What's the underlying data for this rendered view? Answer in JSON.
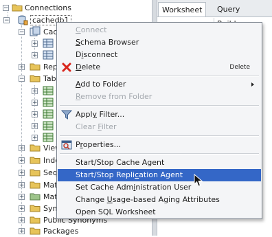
{
  "tree": {
    "items": [
      {
        "label": "Connections",
        "icon": "folder-icon"
      },
      {
        "label": "cachedb1",
        "icon": "database-icon"
      },
      {
        "label": "Cac",
        "icon": "cache-groups-icon"
      },
      {
        "label": "Rep",
        "icon": "folder-icon"
      },
      {
        "label": "Tab",
        "icon": "folder-icon"
      },
      {
        "label": "View",
        "icon": "folder-icon"
      },
      {
        "label": "Inde",
        "icon": "folder-icon"
      },
      {
        "label": "Seq",
        "icon": "folder-icon"
      },
      {
        "label": "Mat",
        "icon": "folder-icon"
      },
      {
        "label": "Mat",
        "icon": "folder-icon"
      },
      {
        "label": "Syn",
        "icon": "folder-icon"
      },
      {
        "label": "Public Synonyms",
        "icon": "folder-icon"
      },
      {
        "label": "Packages",
        "icon": "folder-icon"
      }
    ]
  },
  "editor": {
    "tabs": [
      {
        "label": "Worksheet"
      },
      {
        "label": "Query Builder"
      }
    ]
  },
  "menu": {
    "items": [
      {
        "label": "Connect",
        "mnemonic_index": 0,
        "disabled": true
      },
      {
        "label": "Schema Browser",
        "mnemonic_index": 0,
        "disabled": false
      },
      {
        "label": "Disconnect",
        "mnemonic_index": 1,
        "disabled": false
      },
      {
        "label": "Delete",
        "mnemonic_index": 0,
        "disabled": false,
        "accelerator": "Delete",
        "icon": "red-x-delete-icon"
      },
      {
        "label": "Add to Folder",
        "mnemonic_index": 0,
        "disabled": false,
        "submenu": true
      },
      {
        "label": "Remove from Folder",
        "mnemonic_index": 0,
        "disabled": true
      },
      {
        "label": "Apply Filter...",
        "mnemonic_index": 4,
        "disabled": false,
        "icon": "filter-icon"
      },
      {
        "label": "Clear Filter",
        "mnemonic_index": 6,
        "disabled": true
      },
      {
        "label": "Properties...",
        "mnemonic_index": 1,
        "disabled": false,
        "icon": "properties-icon"
      },
      {
        "label": "Start/Stop Cache Agent",
        "disabled": false
      },
      {
        "label": "Start/Stop Replication Agent",
        "mnemonic_index": 16,
        "disabled": false,
        "selected": true
      },
      {
        "label": "Set Cache Administration User",
        "mnemonic_index": 13,
        "disabled": false
      },
      {
        "label": "Change Usage-based Aging Attributes",
        "mnemonic_index": 7,
        "disabled": false
      },
      {
        "label": "Open SQL Worksheet",
        "disabled": false
      }
    ]
  },
  "colors": {
    "selection": "#3467c7",
    "menu_background": "#f4f5f7",
    "disabled_text": "#a3a8ae",
    "delete_icon": "#d9261c"
  }
}
